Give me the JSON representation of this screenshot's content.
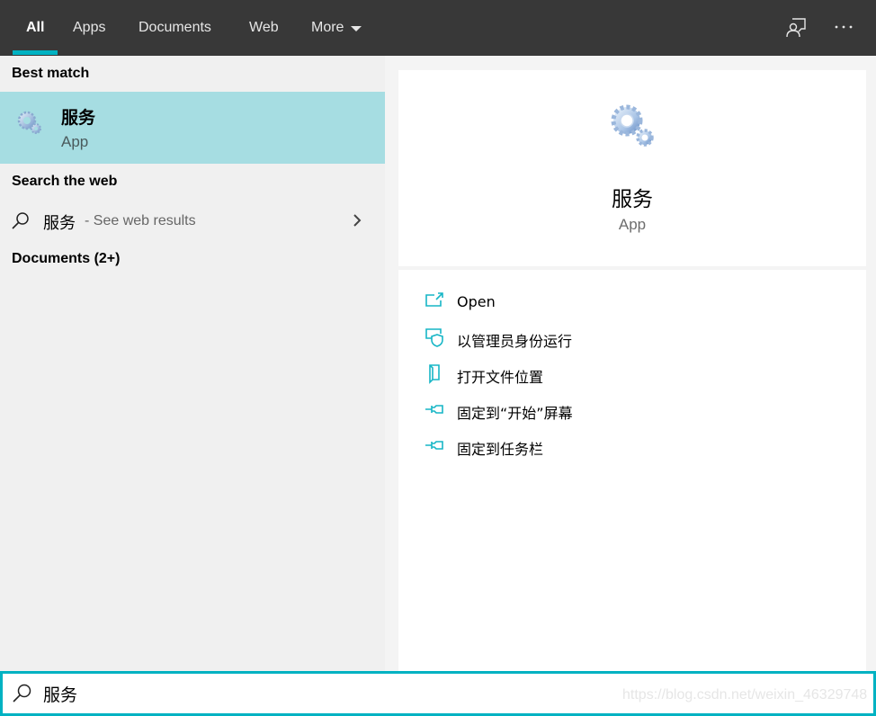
{
  "tabs": [
    {
      "label": "All",
      "active": true
    },
    {
      "label": "Apps"
    },
    {
      "label": "Documents"
    },
    {
      "label": "Web"
    },
    {
      "label": "More"
    }
  ],
  "top_icons": [
    "feedback-icon",
    "more-options-icon"
  ],
  "colors": {
    "accent": "#00b2c2",
    "topbar": "#383838",
    "selected_bg": "#a6dde2",
    "left_bg": "#f0f0f0"
  },
  "left": {
    "best_match_header": "Best match",
    "best_match": {
      "title": "服务",
      "subtitle": "App",
      "icon": "services-gears-icon"
    },
    "search_web_header": "Search the web",
    "web_result": {
      "query": "服务",
      "suffix": "- See web results"
    },
    "documents_header": "Documents (2+)"
  },
  "detail": {
    "title": "服务",
    "subtitle": "App",
    "actions": [
      {
        "label": "Open",
        "icon": "open-icon"
      },
      {
        "label": "以管理员身份运行",
        "icon": "run-as-admin-icon"
      },
      {
        "label": "打开文件位置",
        "icon": "open-file-location-icon"
      },
      {
        "label": "固定到“开始”屏幕",
        "icon": "pin-to-start-icon"
      },
      {
        "label": "固定到任务栏",
        "icon": "pin-to-taskbar-icon"
      }
    ]
  },
  "search": {
    "value": "服务"
  },
  "watermark": "https://blog.csdn.net/weixin_46329748"
}
